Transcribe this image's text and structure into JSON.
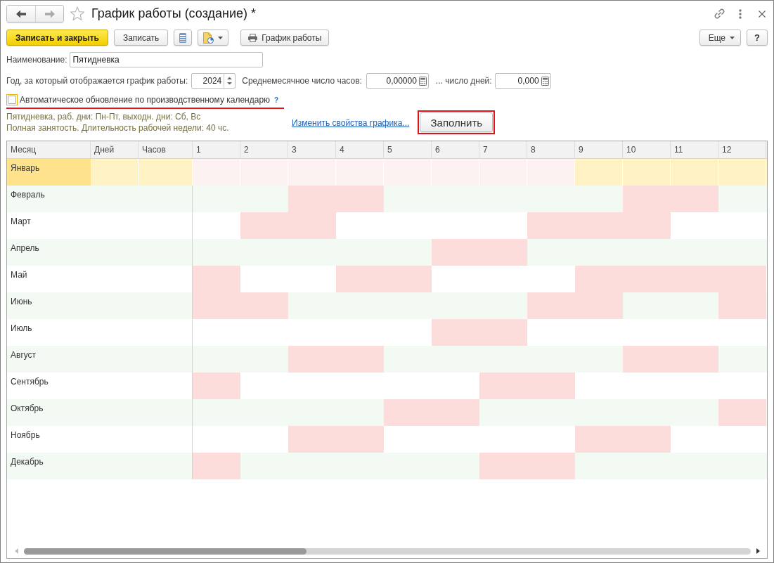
{
  "window": {
    "nav": [
      {
        "kind": "back",
        "disabled": false
      },
      {
        "kind": "forward",
        "disabled": true
      }
    ],
    "title": "График работы (создание) *"
  },
  "toolbar": {
    "buttons": [
      {
        "kind": "primary",
        "label": "Записать и закрыть"
      },
      {
        "kind": "text",
        "label": "Записать"
      },
      {
        "kind": "list"
      },
      {
        "kind": "report-menu"
      },
      {
        "kind": "print",
        "label": "График работы"
      }
    ],
    "right_buttons": [
      {
        "kind": "menu",
        "label": "Еще"
      },
      {
        "kind": "help",
        "label": "?"
      }
    ]
  },
  "form": {
    "name": {
      "label": "Наименование:",
      "value": "Пятидневка"
    },
    "year": {
      "label": "Год, за который отображается график работы:",
      "value": "2024"
    },
    "avg_hours": {
      "label": "Среднемесячное число часов:",
      "value": "0,00000"
    },
    "avg_days": {
      "label": "... число дней:",
      "value": "0,000"
    },
    "auto_update": {
      "label": "Автоматическое обновление по производственному календарю",
      "checked": false,
      "focused": true,
      "help": "?",
      "highlighted": true
    },
    "summary": [
      "Пятидневка, раб. дни: Пн-Пт, выходн. дни: Сб, Вс",
      "Полная занятость. Длительность рабочей недели: 40 чс."
    ],
    "link": "Изменить свойства графика...",
    "fill_button": {
      "label": "Заполнить",
      "highlighted": true
    }
  },
  "table": {
    "columns": [
      "Месяц",
      "Дней",
      "Часов",
      "1",
      "2",
      "3",
      "4",
      "5",
      "6",
      "7",
      "8",
      "9",
      "10",
      "11",
      "12"
    ],
    "rows": [
      {
        "month": "Январь",
        "selected": true,
        "days": [
          {
            "kind": "off"
          },
          {
            "kind": "off"
          },
          {
            "kind": "off"
          },
          {
            "kind": "off"
          },
          {
            "kind": "off"
          },
          {
            "kind": "off"
          },
          {
            "kind": "off"
          },
          {
            "kind": "off"
          },
          {
            "kind": "work"
          },
          {
            "kind": "work"
          },
          {
            "kind": "work"
          },
          {
            "kind": "work"
          }
        ]
      },
      {
        "month": "Февраль",
        "selected": false,
        "days": [
          {
            "kind": "work"
          },
          {
            "kind": "work"
          },
          {
            "kind": "off"
          },
          {
            "kind": "off"
          },
          {
            "kind": "work"
          },
          {
            "kind": "work"
          },
          {
            "kind": "work"
          },
          {
            "kind": "work"
          },
          {
            "kind": "work"
          },
          {
            "kind": "off"
          },
          {
            "kind": "off"
          },
          {
            "kind": "work"
          }
        ]
      },
      {
        "month": "Март",
        "selected": false,
        "days": [
          {
            "kind": "work"
          },
          {
            "kind": "off"
          },
          {
            "kind": "off"
          },
          {
            "kind": "work"
          },
          {
            "kind": "work"
          },
          {
            "kind": "work"
          },
          {
            "kind": "work"
          },
          {
            "kind": "off"
          },
          {
            "kind": "off"
          },
          {
            "kind": "off"
          },
          {
            "kind": "work"
          },
          {
            "kind": "work"
          }
        ]
      },
      {
        "month": "Апрель",
        "selected": false,
        "days": [
          {
            "kind": "work"
          },
          {
            "kind": "work"
          },
          {
            "kind": "work"
          },
          {
            "kind": "work"
          },
          {
            "kind": "work"
          },
          {
            "kind": "off"
          },
          {
            "kind": "off"
          },
          {
            "kind": "work"
          },
          {
            "kind": "work"
          },
          {
            "kind": "work"
          },
          {
            "kind": "work"
          },
          {
            "kind": "work"
          }
        ]
      },
      {
        "month": "Май",
        "selected": false,
        "days": [
          {
            "kind": "off"
          },
          {
            "kind": "work"
          },
          {
            "kind": "work"
          },
          {
            "kind": "off"
          },
          {
            "kind": "off"
          },
          {
            "kind": "work"
          },
          {
            "kind": "work"
          },
          {
            "kind": "work"
          },
          {
            "kind": "off"
          },
          {
            "kind": "off"
          },
          {
            "kind": "off"
          },
          {
            "kind": "off"
          }
        ]
      },
      {
        "month": "Июнь",
        "selected": false,
        "days": [
          {
            "kind": "off"
          },
          {
            "kind": "off"
          },
          {
            "kind": "work"
          },
          {
            "kind": "work"
          },
          {
            "kind": "work"
          },
          {
            "kind": "work"
          },
          {
            "kind": "work"
          },
          {
            "kind": "off"
          },
          {
            "kind": "off"
          },
          {
            "kind": "work"
          },
          {
            "kind": "work"
          },
          {
            "kind": "off"
          }
        ]
      },
      {
        "month": "Июль",
        "selected": false,
        "days": [
          {
            "kind": "work"
          },
          {
            "kind": "work"
          },
          {
            "kind": "work"
          },
          {
            "kind": "work"
          },
          {
            "kind": "work"
          },
          {
            "kind": "off"
          },
          {
            "kind": "off"
          },
          {
            "kind": "work"
          },
          {
            "kind": "work"
          },
          {
            "kind": "work"
          },
          {
            "kind": "work"
          },
          {
            "kind": "work"
          }
        ]
      },
      {
        "month": "Август",
        "selected": false,
        "days": [
          {
            "kind": "work"
          },
          {
            "kind": "work"
          },
          {
            "kind": "off"
          },
          {
            "kind": "off"
          },
          {
            "kind": "work"
          },
          {
            "kind": "work"
          },
          {
            "kind": "work"
          },
          {
            "kind": "work"
          },
          {
            "kind": "work"
          },
          {
            "kind": "off"
          },
          {
            "kind": "off"
          },
          {
            "kind": "work"
          }
        ]
      },
      {
        "month": "Сентябрь",
        "selected": false,
        "days": [
          {
            "kind": "off"
          },
          {
            "kind": "work"
          },
          {
            "kind": "work"
          },
          {
            "kind": "work"
          },
          {
            "kind": "work"
          },
          {
            "kind": "work"
          },
          {
            "kind": "off"
          },
          {
            "kind": "off"
          },
          {
            "kind": "work"
          },
          {
            "kind": "work"
          },
          {
            "kind": "work"
          },
          {
            "kind": "work"
          }
        ]
      },
      {
        "month": "Октябрь",
        "selected": false,
        "days": [
          {
            "kind": "work"
          },
          {
            "kind": "work"
          },
          {
            "kind": "work"
          },
          {
            "kind": "work"
          },
          {
            "kind": "off"
          },
          {
            "kind": "off"
          },
          {
            "kind": "work"
          },
          {
            "kind": "work"
          },
          {
            "kind": "work"
          },
          {
            "kind": "work"
          },
          {
            "kind": "work"
          },
          {
            "kind": "off"
          }
        ]
      },
      {
        "month": "Ноябрь",
        "selected": false,
        "days": [
          {
            "kind": "work"
          },
          {
            "kind": "work"
          },
          {
            "kind": "off"
          },
          {
            "kind": "off"
          },
          {
            "kind": "work"
          },
          {
            "kind": "work"
          },
          {
            "kind": "work"
          },
          {
            "kind": "work"
          },
          {
            "kind": "off"
          },
          {
            "kind": "off"
          },
          {
            "kind": "work"
          },
          {
            "kind": "work"
          }
        ]
      },
      {
        "month": "Декабрь",
        "selected": false,
        "days": [
          {
            "kind": "off"
          },
          {
            "kind": "work"
          },
          {
            "kind": "work"
          },
          {
            "kind": "work"
          },
          {
            "kind": "work"
          },
          {
            "kind": "work"
          },
          {
            "kind": "off"
          },
          {
            "kind": "off"
          },
          {
            "kind": "work"
          },
          {
            "kind": "work"
          },
          {
            "kind": "work"
          },
          {
            "kind": "work"
          }
        ]
      }
    ]
  }
}
